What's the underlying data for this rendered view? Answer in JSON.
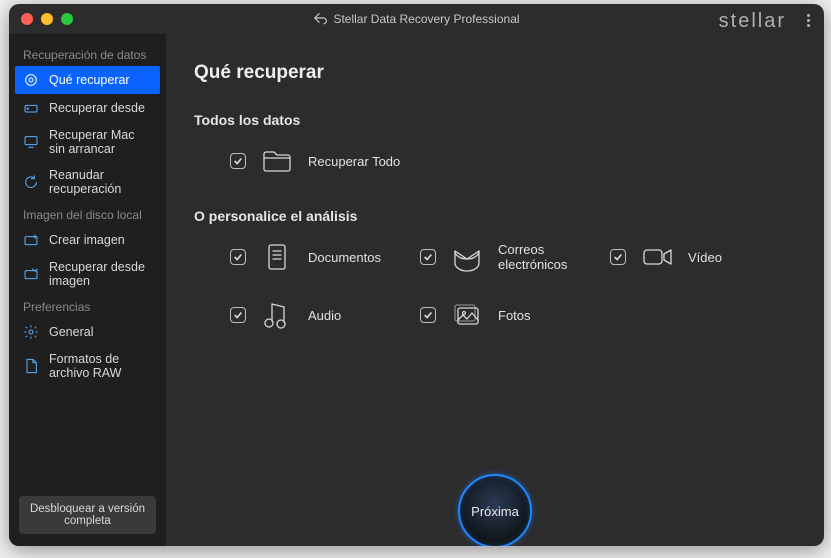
{
  "titlebar": {
    "appTitle": "Stellar Data Recovery Professional",
    "brand": "stellar"
  },
  "sidebar": {
    "groups": [
      {
        "title": "Recuperación de datos",
        "items": [
          {
            "label": "Qué recuperar",
            "icon": "target-icon",
            "active": true
          },
          {
            "label": "Recuperar desde",
            "icon": "drive-icon",
            "active": false
          },
          {
            "label": "Recuperar Mac sin arrancar",
            "icon": "monitor-icon",
            "active": false
          },
          {
            "label": "Reanudar recuperación",
            "icon": "refresh-icon",
            "active": false
          }
        ]
      },
      {
        "title": "Imagen del disco local",
        "items": [
          {
            "label": "Crear imagen",
            "icon": "disk-plus-icon",
            "active": false
          },
          {
            "label": "Recuperar desde imagen",
            "icon": "disk-restore-icon",
            "active": false
          }
        ]
      },
      {
        "title": "Preferencias",
        "items": [
          {
            "label": "General",
            "icon": "gear-icon",
            "active": false
          },
          {
            "label": "Formatos de archivo RAW",
            "icon": "doc-icon",
            "active": false
          }
        ]
      }
    ],
    "unlock": "Desbloquear a versión completa"
  },
  "main": {
    "heading": "Qué recuperar",
    "allSection": {
      "title": "Todos los datos",
      "option": {
        "label": "Recuperar Todo",
        "checked": true
      }
    },
    "customSection": {
      "title": "O personalice el análisis",
      "options": [
        {
          "label": "Documentos",
          "icon": "documents-icon",
          "checked": true
        },
        {
          "label": "Correos electrónicos",
          "icon": "mail-icon",
          "checked": true
        },
        {
          "label": "Vídeo",
          "icon": "video-icon",
          "checked": true
        },
        {
          "label": "Audio",
          "icon": "audio-icon",
          "checked": true
        },
        {
          "label": "Fotos",
          "icon": "photos-icon",
          "checked": true
        }
      ]
    },
    "nextButton": "Próxima"
  }
}
